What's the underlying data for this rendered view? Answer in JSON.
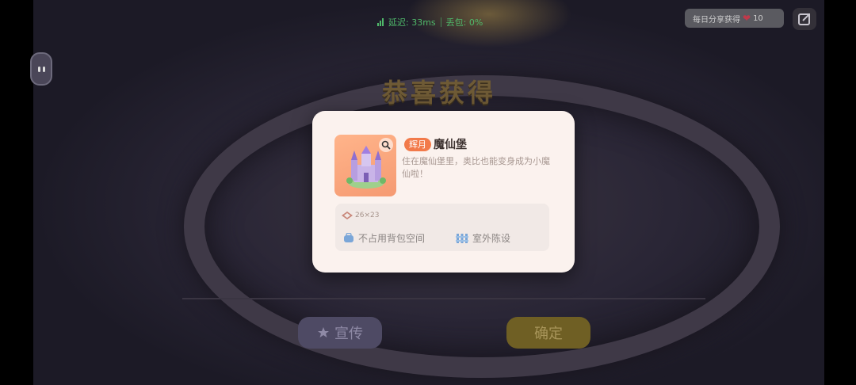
{
  "hud": {
    "latency_label": "延迟: 33ms",
    "packet_loss_label": "丢包: 0%",
    "daily_text": "每日分享获得",
    "daily_count": "10"
  },
  "background": {
    "congrats_title": "恭喜获得",
    "promo_button": "宣传",
    "confirm_button": "确定"
  },
  "modal": {
    "tag": "辉月",
    "item_name": "魔仙堡",
    "description": "住在魔仙堡里，奥比也能变身成为小魔仙啦！",
    "size": "26×23",
    "features": [
      {
        "label": "不占用背包空间",
        "icon": "backpack-icon"
      },
      {
        "label": "室外陈设",
        "icon": "outdoor-fence-icon"
      }
    ]
  },
  "colors": {
    "accent_orange": "#f27a4a",
    "modal_bg": "#fbf2ee",
    "network_green": "#4fb86a"
  }
}
